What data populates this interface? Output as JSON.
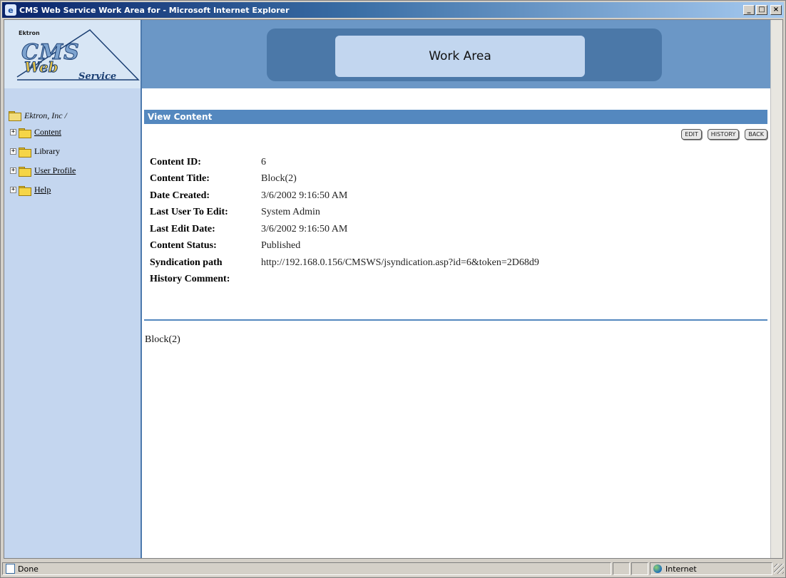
{
  "window": {
    "title": "CMS Web Service Work Area for - Microsoft Internet Explorer",
    "minimize": "_",
    "maximize": "□",
    "close": "×"
  },
  "logo": {
    "ektron": "Ektron",
    "cms": "CMS",
    "web": "Web",
    "service": "Service"
  },
  "header": {
    "work_area": "Work Area"
  },
  "sidebar": {
    "root": "Ektron, Inc /",
    "items": [
      {
        "label": "Content",
        "link": true
      },
      {
        "label": "Library",
        "link": false
      },
      {
        "label": "User Profile",
        "link": true
      },
      {
        "label": "Help",
        "link": true
      }
    ]
  },
  "view": {
    "heading": "View Content",
    "buttons": {
      "edit": "EDIT",
      "history": "HISTORY",
      "back": "BACK"
    },
    "fields": [
      {
        "label": "Content ID:",
        "value": "6"
      },
      {
        "label": "Content Title:",
        "value": "Block(2)"
      },
      {
        "label": "Date Created:",
        "value": "3/6/2002 9:16:50 AM"
      },
      {
        "label": "Last User To Edit:",
        "value": "System Admin"
      },
      {
        "label": "Last Edit Date:",
        "value": "3/6/2002 9:16:50 AM"
      },
      {
        "label": "Content Status:",
        "value": "Published"
      },
      {
        "label": "Syndication path",
        "value": "http://192.168.0.156/CMSWS/jsyndication.asp?id=6&token=2D68d9"
      },
      {
        "label": "History Comment:",
        "value": ""
      }
    ],
    "body": "Block(2)"
  },
  "status": {
    "text": "Done",
    "zone": "Internet"
  }
}
